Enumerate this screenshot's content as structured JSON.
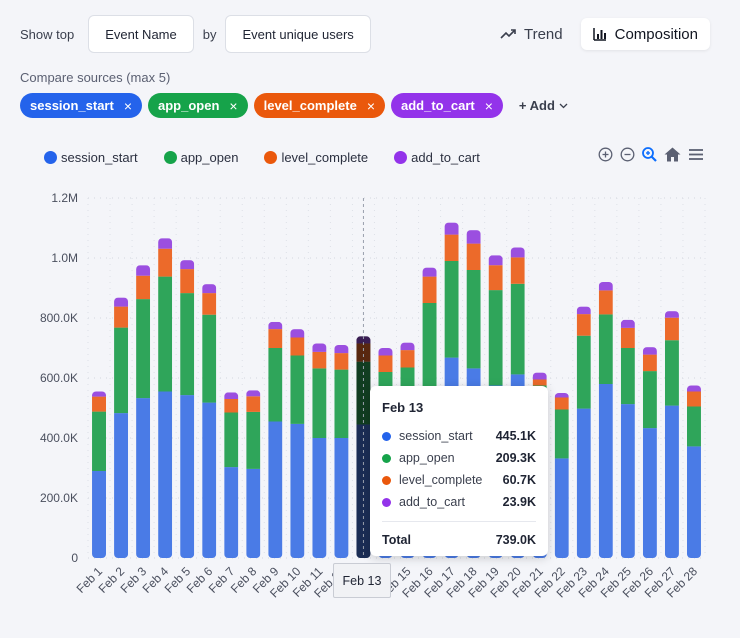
{
  "toolbar": {
    "show_top_label": "Show top",
    "dimension_value": "Event Name",
    "by_label": "by",
    "metric_value": "Event unique users",
    "trend_label": "Trend",
    "composition_label": "Composition"
  },
  "compare": {
    "label": "Compare sources (max 5)",
    "chips": [
      {
        "label": "session_start",
        "color": "#2463eb"
      },
      {
        "label": "app_open",
        "color": "#16a34a"
      },
      {
        "label": "level_complete",
        "color": "#ea580c"
      },
      {
        "label": "add_to_cart",
        "color": "#9333ea"
      }
    ],
    "add_label": "+ Add",
    "remove_glyph": "×"
  },
  "colors": {
    "session_start": "#4a7be6",
    "app_open": "#2fa55a",
    "level_complete": "#ec6a2a",
    "add_to_cart": "#9b4fe0",
    "legend_session_start": "#2463eb",
    "legend_app_open": "#16a34a",
    "legend_level_complete": "#ea580c",
    "legend_add_to_cart": "#9333ea"
  },
  "chart_data": {
    "type": "bar",
    "stacked": true,
    "categories": [
      "Feb 1",
      "Feb 2",
      "Feb 3",
      "Feb 4",
      "Feb 5",
      "Feb 6",
      "Feb 7",
      "Feb 8",
      "Feb 9",
      "Feb 10",
      "Feb 11",
      "Feb 12",
      "Feb 13",
      "Feb 14",
      "Feb 15",
      "Feb 16",
      "Feb 17",
      "Feb 18",
      "Feb 19",
      "Feb 20",
      "Feb 21",
      "Feb 22",
      "Feb 23",
      "Feb 24",
      "Feb 25",
      "Feb 26",
      "Feb 27",
      "Feb 28"
    ],
    "series": [
      {
        "name": "session_start",
        "values": [
          290,
          483,
          533,
          555,
          543,
          518,
          303,
          297,
          455,
          447,
          400,
          400,
          445.1,
          420,
          430,
          535,
          668,
          632,
          575,
          612,
          405,
          332,
          498,
          580,
          513,
          433,
          508,
          372
        ]
      },
      {
        "name": "app_open",
        "values": [
          198,
          285,
          330,
          383,
          340,
          293,
          182,
          190,
          245,
          228,
          232,
          228,
          209.3,
          200,
          205,
          315,
          322,
          328,
          318,
          302,
          170,
          163,
          243,
          232,
          187,
          190,
          218,
          133
        ]
      },
      {
        "name": "level_complete",
        "values": [
          50,
          70,
          78,
          93,
          80,
          72,
          45,
          52,
          63,
          60,
          55,
          55,
          60.7,
          55,
          58,
          88,
          88,
          88,
          83,
          88,
          20,
          40,
          72,
          80,
          67,
          55,
          75,
          50
        ]
      },
      {
        "name": "add_to_cart",
        "values": [
          17,
          30,
          35,
          35,
          30,
          30,
          22,
          20,
          24,
          28,
          28,
          27,
          23.9,
          25,
          25,
          30,
          40,
          45,
          33,
          33,
          23,
          15,
          25,
          28,
          27,
          25,
          22,
          20
        ]
      }
    ],
    "ylim": [
      0,
      1200000
    ],
    "yticks": [
      "0",
      "200.0K",
      "400.0K",
      "600.0K",
      "800.0K",
      "1.0M",
      "1.2M"
    ],
    "value_unit": "thousands",
    "grid": true,
    "legend_position": "top-left",
    "hover_index": 12
  },
  "tooltip": {
    "date": "Feb 13",
    "rows": [
      {
        "name": "session_start",
        "value": "445.1K",
        "color": "#2463eb"
      },
      {
        "name": "app_open",
        "value": "209.3K",
        "color": "#16a34a"
      },
      {
        "name": "level_complete",
        "value": "60.7K",
        "color": "#ea580c"
      },
      {
        "name": "add_to_cart",
        "value": "23.9K",
        "color": "#9333ea"
      }
    ],
    "total_label": "Total",
    "total_value": "739.0K"
  },
  "xaxis_hover_label": "Feb 13"
}
